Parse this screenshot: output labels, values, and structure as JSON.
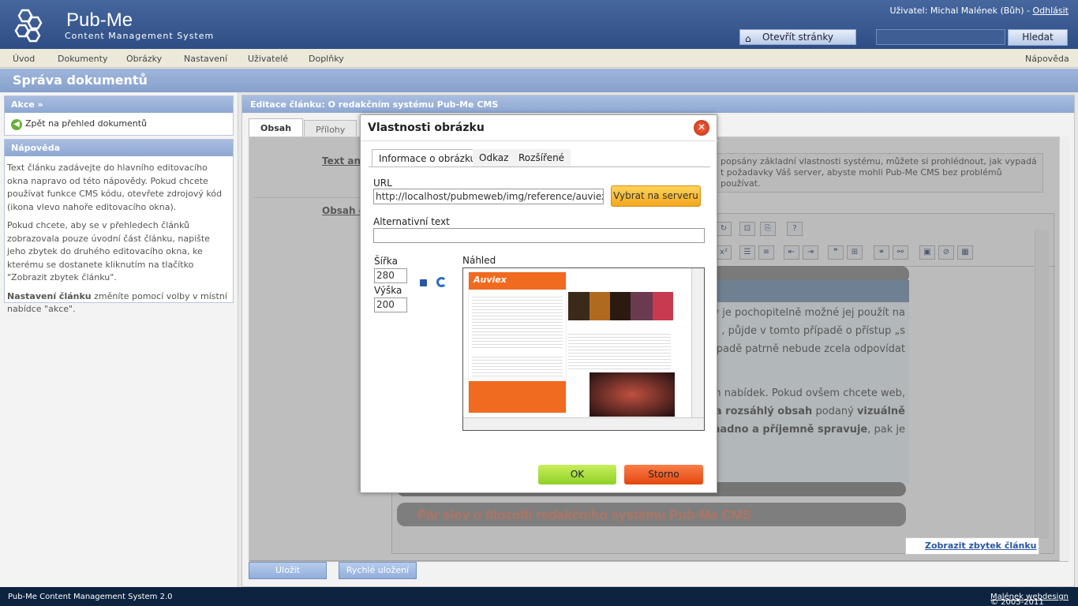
{
  "header": {
    "brand": "Pub-Me",
    "brand_sub": "Content Management System",
    "user_prefix": "Uživatel: Michal Malének (Bůh) - ",
    "logout": "Odhlásit",
    "open_site": "Otevřít stránky",
    "search_value": "",
    "search_button": "Hledat"
  },
  "menu": {
    "items": [
      "Úvod",
      "Dokumenty",
      "Obrázky",
      "Nastavení",
      "Uživatelé",
      "Doplňky"
    ],
    "help": "Nápověda"
  },
  "page_title": "Správa dokumentů",
  "left": {
    "actions_title": "Akce »",
    "back_link": "Zpět na přehled dokumentů",
    "help_title": "Nápověda",
    "help_p1": "Text článku zadávejte do hlavního editovacího okna napravo od této nápovědy. Pokud chcete používat funkce CMS kódu, otevřete zdrojový kód (ikona vlevo nahoře editovacího okna).",
    "help_p2": "Pokud chcete, aby se v přehledech článků zobrazovala pouze úvodní část článku, napište jeho zbytek do druhého editovacího okna, ke kterému se dostanete kliknutím na tlačítko \"Zobrazit zbytek článku\".",
    "help_p3_bold": "Nastavení článku",
    "help_p3_rest": " změníte pomocí volby v místní nabídce \"akce\"."
  },
  "main": {
    "header": "Editace článku: O redakčním systému Pub-Me CMS",
    "tab_content": "Obsah",
    "tab_attachments": "Přílohy",
    "label_annotation": "Text ano",
    "label_content": "Obsah čl",
    "annotation_text": "popsány základní vlastnosti systému, můžete si prohlédnout, jak vypadá\nt požadavky Váš server, abyste mohli Pub-Me CMS bez problémů používat.",
    "article_lines": [
      "liv je pochopitelně možné jej použít na",
      ", půjde v tomto případě o přístup „s",
      "řípadě patrně nebude zcela odpovídat",
      "",
      "ých nabídek. Pokud ovšem chcete web,"
    ],
    "article_line6_a": " a rozsáhlý obsah",
    "article_line6_b": " podaný ",
    "article_line6_c": "vizuálně",
    "article_line7_a": "snadno a příjemně spravuje",
    "article_line7_b": ", pak je",
    "article_title2": "Pár slov o filozofii redakčního systému Pub-Me CMS",
    "show_rest": "Zobrazit zbytek článku",
    "save": "Uložit",
    "quick_save": "Rychlé uložení"
  },
  "dialog": {
    "title": "Vlastnosti obrázku",
    "tabs": [
      "Informace o obrázku",
      "Odkaz",
      "Rozšířené"
    ],
    "url_label": "URL",
    "url_value": "http://localhost/pubmeweb/img/reference/auviex/_hon",
    "browse": "Vybrat na serveru",
    "alt_label": "Alternativní text",
    "alt_value": "",
    "width_label": "Šířka",
    "width_value": "280",
    "height_label": "Výška",
    "height_value": "200",
    "preview_label": "Náhled",
    "preview_brand": "Auviex",
    "ok": "OK",
    "cancel": "Storno"
  },
  "footer": {
    "left": "Pub-Me Content Management System 2.0",
    "right_prefix": "© 2005-2011 ",
    "right_link": "Malének webdesign"
  },
  "colors": {
    "header_blue": "#2e4d85",
    "ok_green": "#8fd027",
    "cancel_orange": "#e4470e",
    "browse_yellow": "#f2a71d"
  }
}
